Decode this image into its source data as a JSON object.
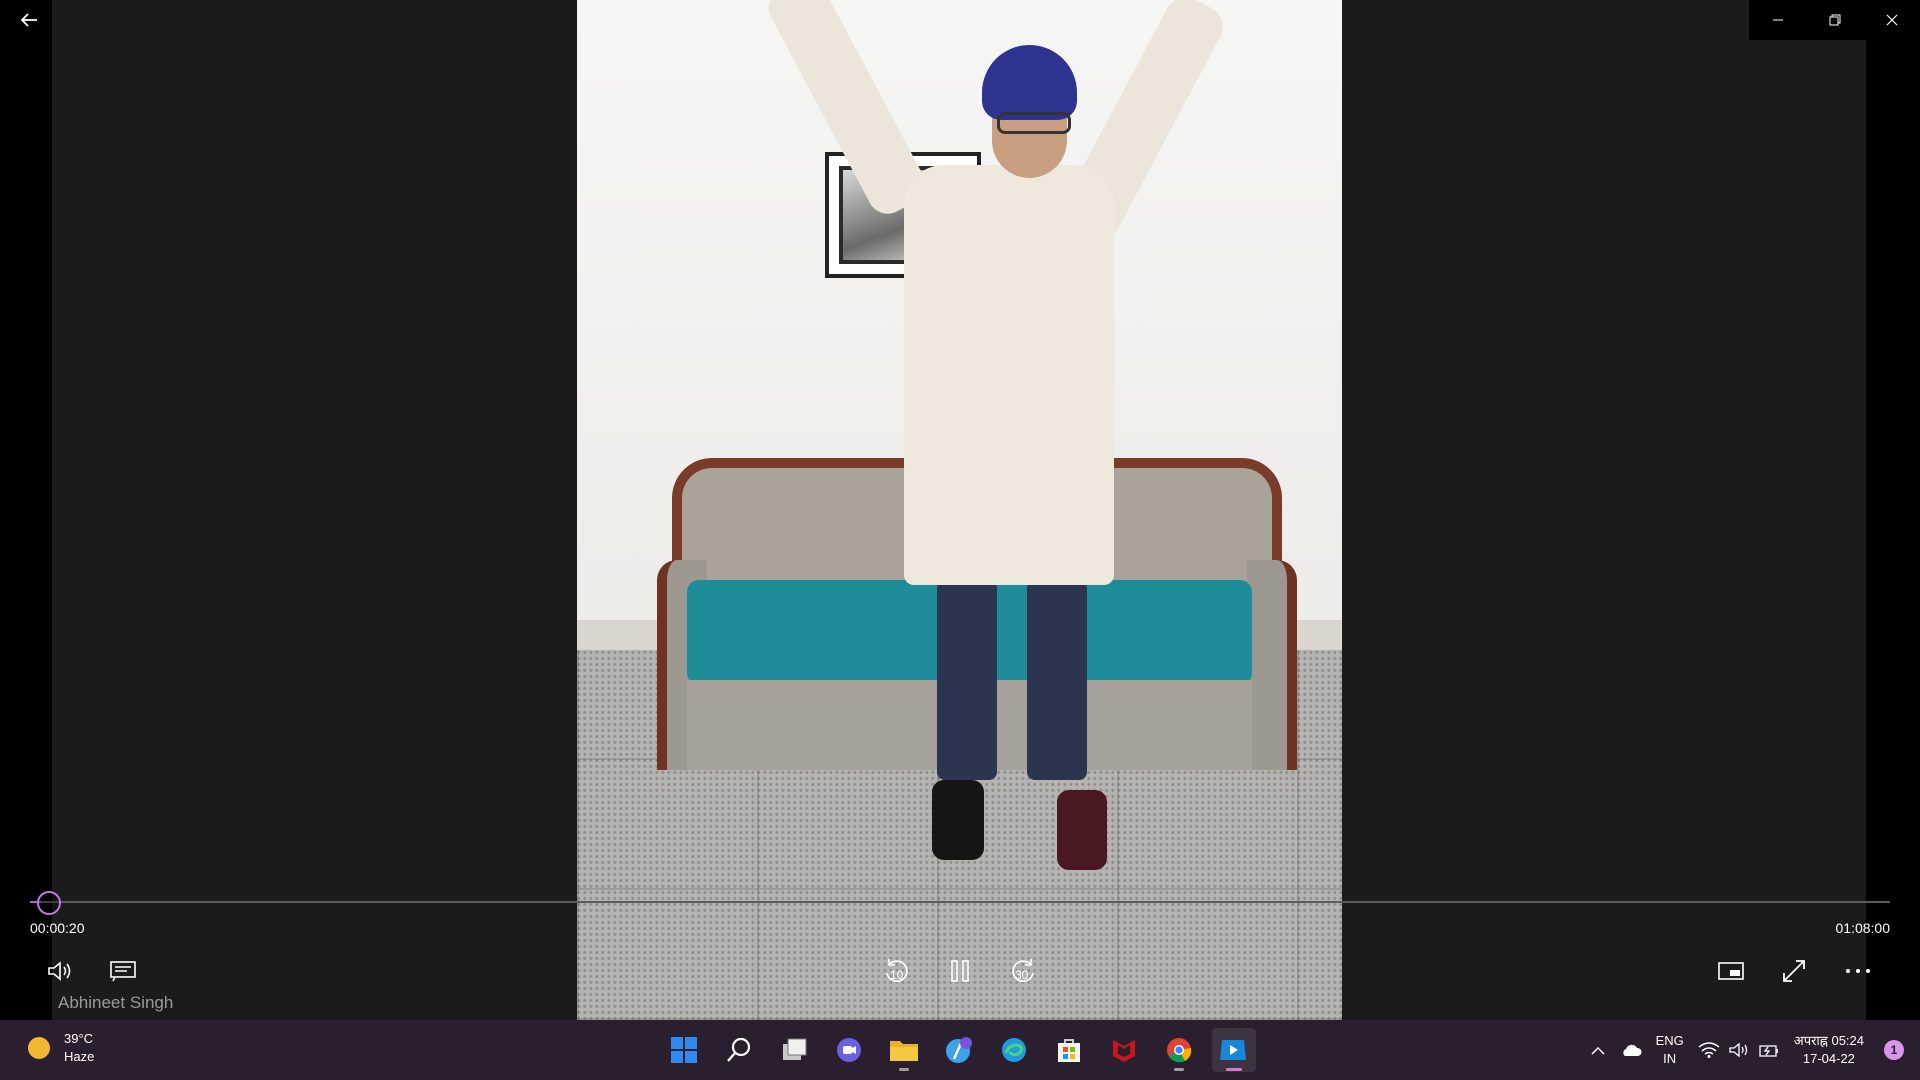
{
  "player": {
    "current_time": "00:00:20",
    "total_time": "01:08:00",
    "progress_fraction": 0.005,
    "video_title": "Abhineet Singh",
    "skip_back_label": "10",
    "skip_forward_label": "30",
    "accent_color": "#b25bd6"
  },
  "window": {
    "back_icon": "back-arrow-icon",
    "minimize_icon": "minimize-icon",
    "restore_icon": "restore-icon",
    "close_icon": "close-icon"
  },
  "taskbar": {
    "weather_temp": "39°C",
    "weather_desc": "Haze",
    "apps": [
      "start-icon",
      "search-icon",
      "task-view-icon",
      "chat-icon",
      "file-explorer-icon",
      "music-icon",
      "edge-icon",
      "store-icon",
      "mcafee-icon",
      "chrome-icon",
      "media-player-icon"
    ],
    "lang_line1": "ENG",
    "lang_line2": "IN",
    "clock_time": "अपराह्न 05:24",
    "clock_date": "17-04-22",
    "notification_count": "1"
  }
}
